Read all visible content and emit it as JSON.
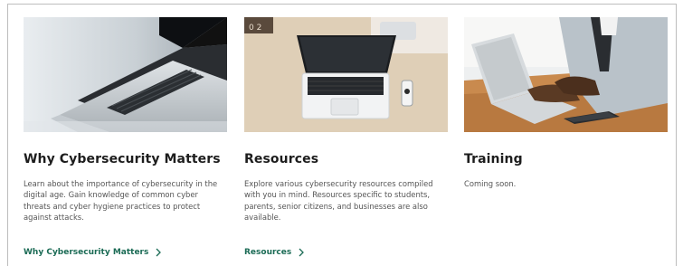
{
  "cards": [
    {
      "title": "Why Cybersecurity Matters",
      "description": "Learn about the importance of cybersecurity in the digital age. Gain knowledge of common cyber threats and cyber hygiene practices to protect against attacks.",
      "link_label": "Why Cybersecurity Matters",
      "image": "laptop-closeup-photo"
    },
    {
      "title": "Resources",
      "description": "Explore various cybersecurity resources compiled with you in mind. Resources specific to students, parents, senior citizens, and businesses are also available.",
      "link_label": "Resources",
      "image": "laptop-on-desk-photo"
    },
    {
      "title": "Training",
      "description": "Coming soon.",
      "image": "person-typing-photo"
    }
  ],
  "icons": {
    "link_arrow": "chevron-right-icon"
  },
  "colors": {
    "link": "#1b6b55",
    "title": "#1d1d1d",
    "body": "#555555",
    "border": "#bdbdbd"
  }
}
